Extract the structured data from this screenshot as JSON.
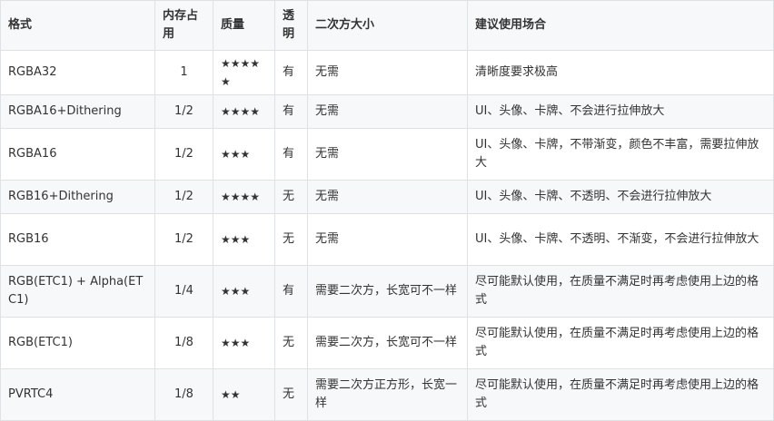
{
  "table": {
    "headers": [
      "格式",
      "内存占用",
      "质量",
      "透明",
      "二次方大小",
      "建议使用场合"
    ],
    "rows": [
      [
        "RGBA32",
        "1",
        "★★★★★",
        "有",
        "无需",
        "清晰度要求极高"
      ],
      [
        "RGBA16+Dithering",
        "1/2",
        "★★★★",
        "有",
        "无需",
        "UI、头像、卡牌、不会进行拉伸放大"
      ],
      [
        "RGBA16",
        "1/2",
        "★★★",
        "有",
        "无需",
        "UI、头像、卡牌，不带渐变，颜色不丰富，需要拉伸放大"
      ],
      [
        "RGB16+Dithering",
        "1/2",
        "★★★★",
        "无",
        "无需",
        "UI、头像、卡牌、不透明、不会进行拉伸放大"
      ],
      [
        "RGB16",
        "1/2",
        "★★★",
        "无",
        "无需",
        "UI、头像、卡牌、不透明、不渐变，不会进行拉伸放大"
      ],
      [
        "RGB(ETC1) + Alpha(ETC1)",
        "1/4",
        "★★★",
        "有",
        "需要二次方，长宽可不一样",
        "尽可能默认使用，在质量不满足时再考虑使用上边的格式"
      ],
      [
        "RGB(ETC1)",
        "1/8",
        "★★★",
        "无",
        "需要二次方，长宽可不一样",
        "尽可能默认使用，在质量不满足时再考虑使用上边的格式"
      ],
      [
        "PVRTC4",
        "1/8",
        "★★",
        "无",
        "需要二次方正方形，长宽一样",
        "尽可能默认使用，在质量不满足时再考虑使用上边的格式"
      ]
    ]
  }
}
